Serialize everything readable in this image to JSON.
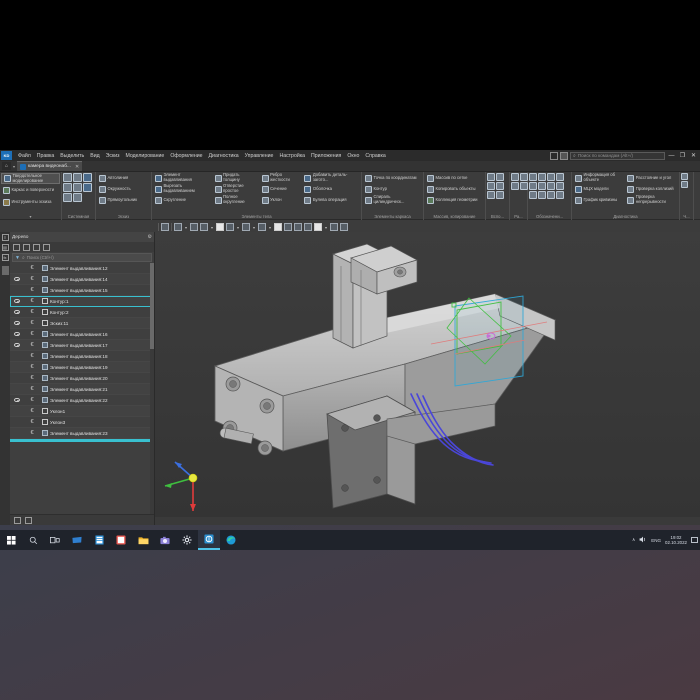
{
  "window": {
    "app_logo": "KD",
    "search_placeholder": "Поиск по командам (Alt+/)",
    "minimize": "—",
    "restore": "❐",
    "close": "✕"
  },
  "menu": {
    "items": [
      {
        "label": "Файл"
      },
      {
        "label": "Правка"
      },
      {
        "label": "Выделить"
      },
      {
        "label": "Вид"
      },
      {
        "label": "Эскиз"
      },
      {
        "label": "Моделирование"
      },
      {
        "label": "Оформление"
      },
      {
        "label": "Диагностика"
      },
      {
        "label": "Управление"
      },
      {
        "label": "Настройка"
      },
      {
        "label": "Приложения"
      },
      {
        "label": "Окно"
      },
      {
        "label": "Справка"
      }
    ]
  },
  "tabs": {
    "home_icon": "home-icon",
    "document": {
      "label": "камера видеонаб...",
      "close": "✕"
    }
  },
  "ribbon": {
    "modes": [
      {
        "label": "Твердотельное моделирование",
        "active": true
      },
      {
        "label": "Каркас и поверхности",
        "active": false
      },
      {
        "label": "Инструменты эскиза",
        "active": false
      }
    ],
    "groups": [
      {
        "title": "Системная",
        "kind": "icons",
        "icons": [
          "new-document-icon",
          "open-folder-icon",
          "save-icon",
          "print-icon",
          "print-preview-icon",
          "export-icon",
          "undo-icon",
          "redo-icon"
        ]
      },
      {
        "title": "Эскиз",
        "kind": "list",
        "buttons": [
          {
            "label": "Автолиния",
            "icon": "autoline-icon"
          },
          {
            "label": "Окружность",
            "icon": "circle-icon"
          },
          {
            "label": "Прямоугольник",
            "icon": "rectangle-icon"
          }
        ]
      },
      {
        "title": "Элементы тела",
        "kind": "list3",
        "col1": [
          {
            "label": "Элемент выдавливания",
            "icon": "extrude-icon"
          },
          {
            "label": "Вырезать выдавливанием",
            "icon": "cut-extrude-icon"
          },
          {
            "label": "Скругление",
            "icon": "fillet-icon"
          }
        ],
        "col2": [
          {
            "label": "Придать толщину",
            "icon": "thicken-icon"
          },
          {
            "label": "Отверстие простое",
            "icon": "hole-icon"
          },
          {
            "label": "Полное округление",
            "icon": "full-round-icon"
          }
        ],
        "col3": [
          {
            "label": "Ребро жесткости",
            "icon": "rib-icon"
          },
          {
            "label": "Сечение",
            "icon": "section-icon"
          },
          {
            "label": "Уклон",
            "icon": "draft-icon"
          }
        ],
        "col4": [
          {
            "label": "Добавить деталь-загото...",
            "icon": "add-part-icon"
          },
          {
            "label": "Оболочка",
            "icon": "shell-icon"
          },
          {
            "label": "Булева операция",
            "icon": "boolean-icon"
          }
        ]
      },
      {
        "title": "Элементы каркаса",
        "kind": "list",
        "buttons": [
          {
            "label": "Точка по координатам",
            "icon": "point-icon"
          },
          {
            "label": "Контур",
            "icon": "contour-icon"
          },
          {
            "label": "Спираль цилиндрическ...",
            "icon": "helix-icon"
          }
        ]
      },
      {
        "title": "Массив, копирование",
        "kind": "list",
        "buttons": [
          {
            "label": "Массив по сетке",
            "icon": "grid-array-icon"
          },
          {
            "label": "Копировать объекты",
            "icon": "copy-objects-icon"
          },
          {
            "label": "Коллекция геометрии",
            "icon": "geometry-collection-icon"
          }
        ]
      },
      {
        "title": "Вспо...",
        "kind": "icons4",
        "icons": [
          "plane-icon",
          "axis-icon",
          "lcs-icon",
          "mirror-icon",
          "point-aux-icon",
          "curve-icon"
        ]
      },
      {
        "title": "Ра...",
        "kind": "icons4",
        "icons": [
          "measure-icon",
          "area-icon",
          "length-icon",
          "angle-icon"
        ]
      },
      {
        "title": "Обозначени...",
        "kind": "icons4",
        "icons": [
          "thread-icon",
          "dimension-icon",
          "roughness-icon",
          "base-icon",
          "weld-icon",
          "tolerance-icon",
          "marking-icon",
          "leader-icon",
          "datum-icon",
          "note-icon",
          "symbol-icon",
          "label-icon"
        ]
      },
      {
        "title": "Диагностика",
        "kind": "list",
        "buttons": [
          {
            "label": "Информация об объекте",
            "icon": "object-info-icon"
          },
          {
            "label": "МЦХ модели",
            "icon": "mass-properties-icon"
          },
          {
            "label": "График кривизны",
            "icon": "curvature-graph-icon"
          }
        ],
        "buttons2": [
          {
            "label": "Расстояние и угол",
            "icon": "distance-angle-icon"
          },
          {
            "label": "Проверка коллизий",
            "icon": "collision-check-icon"
          },
          {
            "label": "Проверка непрерывности",
            "icon": "continuity-check-icon"
          }
        ]
      },
      {
        "title": "Ч...",
        "kind": "icons2",
        "icons": [
          "drawing-icon",
          "spec-icon"
        ]
      }
    ]
  },
  "tree_panel": {
    "title": "Дерево",
    "settings_icon": "gear-icon",
    "toolbar_icons": [
      "tree-view-icon",
      "structure-icon",
      "hide-icon",
      "selection-icon"
    ],
    "search_placeholder": "Поиск (Ctrl+/)",
    "filter_icon": "filter-icon",
    "footer_icons": [
      "model-tree-icon",
      "list-view-icon"
    ],
    "side_icons": [
      "tree-icon",
      "list-icon",
      "variables-icon"
    ],
    "items": [
      {
        "label": "Элемент выдавливания:12",
        "icon": "extrude-icon",
        "eye": false,
        "mark": "€"
      },
      {
        "label": "Элемент выдавливания:14",
        "icon": "extrude-icon",
        "eye": true,
        "mark": "€"
      },
      {
        "label": "Элемент выдавливания:15",
        "icon": "extrude-icon",
        "eye": false,
        "mark": "€"
      },
      {
        "label": "Контур:1",
        "icon": "contour-icon",
        "eye": true,
        "mark": "€",
        "selected": true
      },
      {
        "label": "Контур:2",
        "icon": "contour-icon",
        "eye": true,
        "mark": "€"
      },
      {
        "label": "Эскиз:11",
        "icon": "sketch-icon",
        "eye": true,
        "mark": "€"
      },
      {
        "label": "Элемент выдавливания:16",
        "icon": "extrude-icon",
        "eye": true,
        "mark": "€"
      },
      {
        "label": "Элемент выдавливания:17",
        "icon": "extrude-icon",
        "eye": true,
        "mark": "€"
      },
      {
        "label": "Элемент выдавливания:18",
        "icon": "extrude-icon",
        "eye": false,
        "mark": "€"
      },
      {
        "label": "Элемент выдавливания:19",
        "icon": "extrude-icon",
        "eye": false,
        "mark": "€"
      },
      {
        "label": "Элемент выдавливания:20",
        "icon": "extrude-icon",
        "eye": false,
        "mark": "€"
      },
      {
        "label": "Элемент выдавливания:21",
        "icon": "extrude-icon",
        "eye": false,
        "mark": "€"
      },
      {
        "label": "Элемент выдавливания:22",
        "icon": "extrude-icon",
        "eye": true,
        "mark": "€"
      },
      {
        "label": "Уклон1",
        "icon": "draft-icon",
        "eye": false,
        "mark": "€"
      },
      {
        "label": "Уклон3",
        "icon": "draft-icon",
        "eye": false,
        "mark": "€"
      },
      {
        "label": "Элемент выдавливания:23",
        "icon": "extrude-icon",
        "eye": false,
        "mark": "€"
      }
    ]
  },
  "viewport": {
    "toolbar_icons": [
      "orientation-icon",
      "zoom-icon",
      "zoom-dropdown-icon",
      "pan-icon",
      "rotate-icon",
      "rotate-dropdown-icon",
      "shaded-with-edges-icon",
      "display-mode-icon",
      "display-dropdown-icon",
      "section-view-icon",
      "section-dropdown-icon",
      "hide-show-icon",
      "hide-dropdown-icon",
      "fit-to-screen-icon",
      "layers-icon",
      "perspective-icon",
      "shadow-icon",
      "filter-icon",
      "filter-dropdown-icon",
      "render-icon",
      "edit-icon"
    ],
    "axes": {
      "x_color": "#e03b3b",
      "y_color": "#3fbf3f",
      "z_color": "#3b6fe0",
      "origin_color": "#e8e840"
    },
    "model": {
      "name": "камера видеонаблюдения",
      "body_color": "#b8b8b8",
      "edge_color": "#5a5a5a",
      "spline_color": "#4a46d8",
      "plane_colors": [
        "#3fbf3f",
        "#2fa8d8",
        "#c86ad8"
      ]
    }
  },
  "taskbar": {
    "start_icon": "windows-start-icon",
    "items": [
      {
        "icon": "search-icon",
        "active": false
      },
      {
        "icon": "task-view-icon",
        "active": false
      },
      {
        "icon": "mail-icon",
        "active": false
      },
      {
        "icon": "store-icon",
        "active": false
      },
      {
        "icon": "photos-icon",
        "active": false
      },
      {
        "icon": "file-explorer-icon",
        "active": false
      },
      {
        "icon": "camera-icon",
        "active": false
      },
      {
        "icon": "settings-icon",
        "active": false
      },
      {
        "icon": "kompas-icon",
        "active": true
      },
      {
        "icon": "edge-icon",
        "active": false
      }
    ],
    "tray": {
      "chevron": "∧",
      "volume_icon": "volume-icon",
      "language": "ENG",
      "time": "19:02",
      "date": "02.10.2022",
      "notification_icon": "notification-icon"
    }
  }
}
